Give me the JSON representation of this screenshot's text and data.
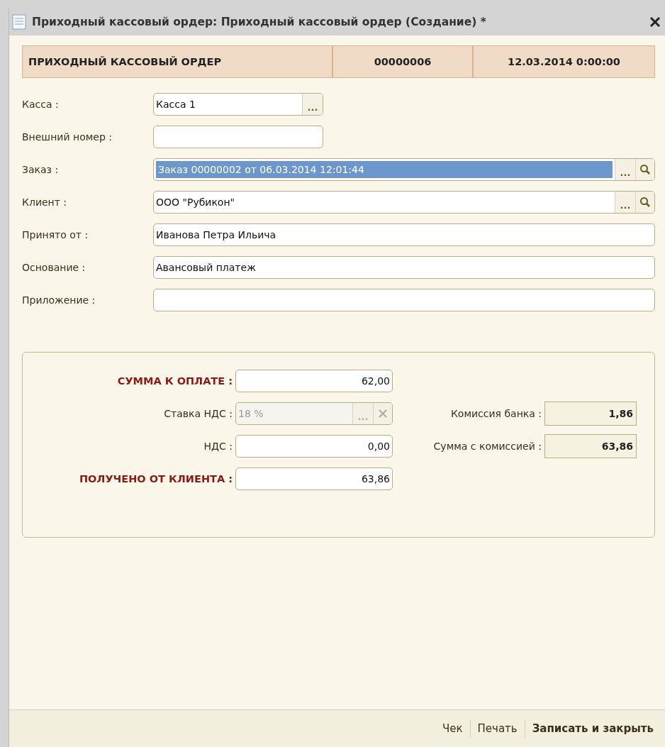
{
  "window": {
    "title": "Приходный кассовый ордер: Приходный кассовый ордер (Создание) *"
  },
  "header": [
    "ПРИХОДНЫЙ КАССОВЫЙ ОРДЕР",
    "00000006",
    "12.03.2014 0:00:00"
  ],
  "fields": [
    {
      "kind": "picker",
      "label": "Касса :",
      "value": "Касса 1",
      "select_button": "...",
      "highlighted": false
    },
    {
      "kind": "short",
      "label": "Внешний номер :",
      "highlighted": false
    },
    {
      "kind": "lookup",
      "label": "Заказ :",
      "value": "Заказ 00000002 от 06.03.2014 12:01:44",
      "select_button": "...",
      "highlighted": true
    },
    {
      "kind": "lookup",
      "label": "Клиент :",
      "value": "ООО \"Рубикон\"",
      "select_button": "...",
      "highlighted": false
    },
    {
      "kind": "text",
      "label": "Принято от :",
      "value": "Иванова Петра Ильича",
      "highlighted": false
    },
    {
      "kind": "text",
      "label": "Основание :",
      "value": "Авансовый платеж",
      "highlighted": false
    },
    {
      "kind": "text",
      "label": "Приложение :",
      "highlighted": false
    }
  ],
  "amounts": [
    {
      "kind": "number",
      "label": "СУММА К ОПЛАТЕ :",
      "value": "62,00",
      "emphasis": true,
      "disabled": false
    },
    {
      "kind": "choice",
      "label": "Ставка НДС :",
      "value": "18 %",
      "select_button": "...",
      "emphasis": false,
      "disabled": true
    },
    {
      "kind": "number",
      "label": "НДС :",
      "value": "0,00",
      "emphasis": false,
      "disabled": false
    },
    {
      "kind": "number",
      "label": "ПОЛУЧЕНО ОТ КЛИЕНТА :",
      "value": "63,86",
      "emphasis": true,
      "disabled": false
    }
  ],
  "commission": [
    {
      "label": "Комиссия банка :",
      "value": "1,86"
    },
    {
      "label": "Сумма с комиссией :",
      "value": "63,86"
    }
  ],
  "footer_buttons": [
    {
      "label": "Чек",
      "primary": false
    },
    {
      "label": "Печать",
      "primary": false
    },
    {
      "label": "Записать и закрыть",
      "primary": true
    }
  ]
}
